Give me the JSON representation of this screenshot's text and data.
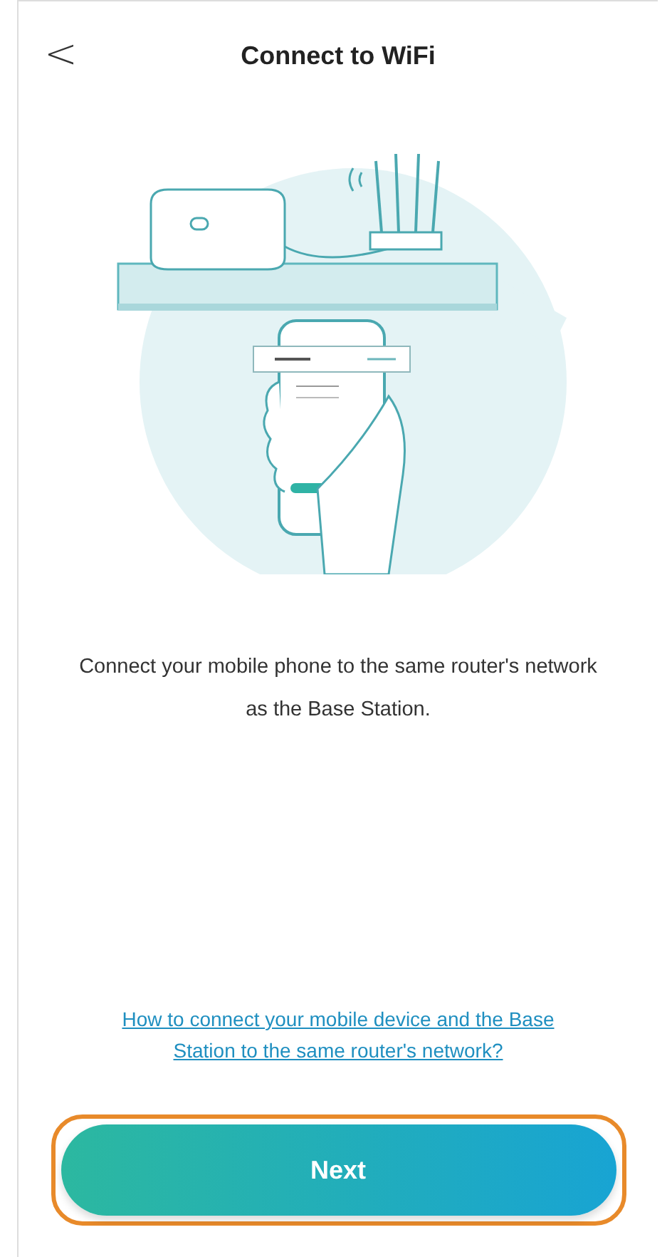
{
  "header": {
    "back": "<",
    "title": "Connect to WiFi"
  },
  "description": "Connect your mobile phone to the same router's network as the Base Station.",
  "help_link": "How to connect your mobile device and the Base Station to the same router's network?",
  "next_button": {
    "label": "Next",
    "highlighted": true
  }
}
